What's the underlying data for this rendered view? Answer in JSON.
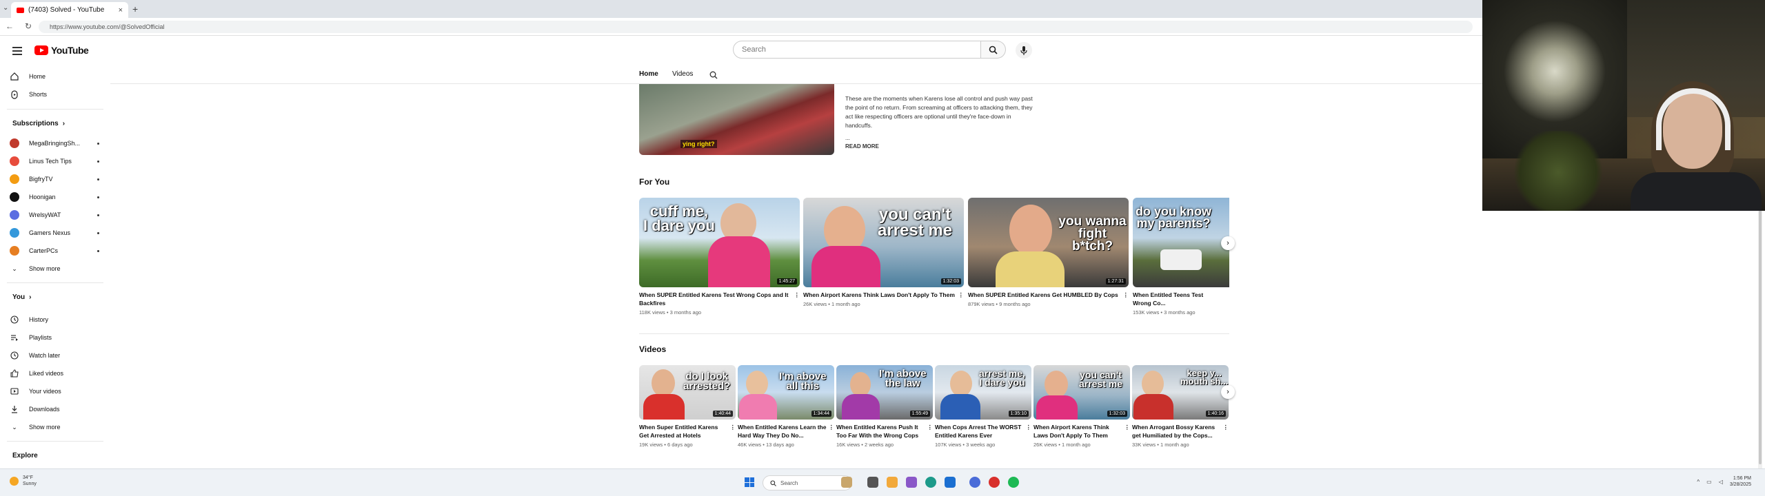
{
  "browser": {
    "tab_title": "(7403) Solved - YouTube",
    "url": "https://www.youtube.com/@SolvedOfficial"
  },
  "header": {
    "logo_text": "YouTube",
    "search_placeholder": "Search"
  },
  "sidebar": {
    "main": [
      {
        "label": "Home",
        "icon": "home-icon"
      },
      {
        "label": "Shorts",
        "icon": "shorts-icon"
      }
    ],
    "subscriptions_title": "Subscriptions",
    "subscriptions": [
      {
        "label": "MegaBringingSh...",
        "color": "#c0392b"
      },
      {
        "label": "Linus Tech Tips",
        "color": "#e74c3c"
      },
      {
        "label": "BigfryTV",
        "color": "#f39c12"
      },
      {
        "label": "Hoonigan",
        "color": "#111111"
      },
      {
        "label": "WrelsyWAT",
        "color": "#5b6ee1"
      },
      {
        "label": "Gamers Nexus",
        "color": "#3498db"
      },
      {
        "label": "CarterPCs",
        "color": "#e67e22"
      }
    ],
    "show_more": "Show more",
    "you_title": "You",
    "you_items": [
      {
        "label": "History",
        "icon": "history-icon"
      },
      {
        "label": "Playlists",
        "icon": "playlists-icon"
      },
      {
        "label": "Watch later",
        "icon": "watch-later-icon"
      },
      {
        "label": "Liked videos",
        "icon": "liked-icon"
      },
      {
        "label": "Your videos",
        "icon": "your-videos-icon"
      },
      {
        "label": "Downloads",
        "icon": "downloads-icon"
      }
    ],
    "you_show_more": "Show more",
    "explore_title": "Explore"
  },
  "channel_tabs": [
    "Home",
    "Videos"
  ],
  "featured": {
    "caption_prefix": "",
    "caption_highlight": "ying right?",
    "description": "These are the moments when Karens lose all control and push way past the point of no return. From screaming at officers to attacking them, they act like respecting officers are optional until they're face-down in handcuffs.",
    "ellipsis": "...",
    "read_more": "READ MORE"
  },
  "for_you": {
    "title": "For You",
    "videos": [
      {
        "overlay": "cuff me,\nI dare you",
        "duration": "1:45:27",
        "title": "When SUPER Entitled Karens Test Wrong Cops and It Backfires",
        "meta": "118K views • 3 months ago"
      },
      {
        "overlay": "you can't\narrest me",
        "duration": "1:32:03",
        "title": "When Airport Karens Think Laws Don't Apply To Them",
        "meta": "26K views • 1 month ago"
      },
      {
        "overlay": "you wanna\nfight b*tch?",
        "duration": "1:27:31",
        "title": "When SUPER Entitled Karens Get HUMBLED By Cops",
        "meta": "879K views • 9 months ago"
      },
      {
        "overlay": "do you know\nmy parents?",
        "duration": "",
        "title": "When Entitled Teens Test Wrong Co...",
        "meta": "153K views • 3 months ago"
      }
    ]
  },
  "videos_section": {
    "title": "Videos",
    "videos": [
      {
        "overlay": "do I look\narrested?",
        "duration": "1:40:44",
        "title": "When Super Entitled Karens Get Arrested at Hotels",
        "meta": "19K views • 6 days ago"
      },
      {
        "overlay": "I'm above\nall this",
        "duration": "1:34:44",
        "title": "When Entitled Karens Learn the Hard Way They Do No...",
        "meta": "46K views • 13 days ago"
      },
      {
        "overlay": "I'm above\nthe law",
        "duration": "1:55:49",
        "title": "When Entitled Karens Push It Too Far With the Wrong Cops",
        "meta": "16K views • 2 weeks ago"
      },
      {
        "overlay": "arrest me,\nI dare you",
        "duration": "1:35:10",
        "title": "When Cops Arrest The WORST Entitled Karens Ever",
        "meta": "107K views • 3 weeks ago"
      },
      {
        "overlay": "you can't\narrest me",
        "duration": "1:32:03",
        "title": "When Airport Karens Think Laws Don't Apply To Them",
        "meta": "26K views • 1 month ago"
      },
      {
        "overlay": "keep y...\nmouth sh...",
        "duration": "1:40:16",
        "title": "When Arrogant Bossy Karens get Humiliated by the Cops...",
        "meta": "33K views • 1 month ago"
      }
    ]
  },
  "taskbar": {
    "weather_temp": "34°F",
    "weather_cond": "Sunny",
    "search": "Search",
    "time": "1:56 PM",
    "date": "3/28/2025"
  }
}
